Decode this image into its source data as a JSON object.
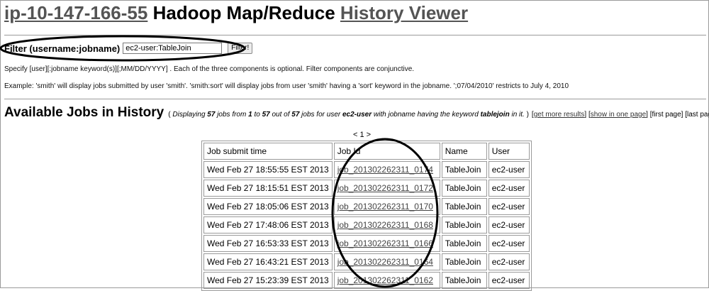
{
  "header": {
    "host": "ip-10-147-166-55",
    "middle": " Hadoop Map/Reduce ",
    "viewer": "History Viewer"
  },
  "filter": {
    "label": "Filter (username:jobname)",
    "value": "ec2-user:TableJoin",
    "button": "Filter!"
  },
  "notes": {
    "spec": "Specify [user][:jobname keyword(s)][;MM/DD/YYYY] . Each of the three components is optional. Filter components are conjunctive.",
    "example": "Example: 'smith' will display jobs submitted by user 'smith'. 'smith:sort' will display jobs from user 'smith' having a 'sort' keyword in the jobname. ';07/04/2010' restricts to July 4, 2010"
  },
  "jobs_section": {
    "heading": "Available Jobs in History",
    "open_paren": " ( ",
    "d1": "Displaying ",
    "shown": "57",
    "d2": " jobs from ",
    "from": "1",
    "d3": " to ",
    "to": "57",
    "d4": " out of ",
    "total": "57",
    "d5": " jobs for user ",
    "user": "ec2-user",
    "d6": " with jobname having the keyword ",
    "keyword": "tablejoin",
    "d7": " in it.",
    "close_paren": " ) ",
    "get_more": "get more results",
    "show_one_page": "show in one page",
    "first_page": "[first page]",
    "last_page": "[last page]"
  },
  "pager": {
    "prev": "< ",
    "page": "1",
    "next": " >"
  },
  "table": {
    "headers": [
      "Job submit time",
      "Job Id",
      "Name",
      "User"
    ],
    "rows": [
      [
        "Wed Feb 27 18:55:55 EST 2013",
        "job_201302262311_0174",
        "TableJoin",
        "ec2-user"
      ],
      [
        "Wed Feb 27 18:15:51 EST 2013",
        "job_201302262311_0172",
        "TableJoin",
        "ec2-user"
      ],
      [
        "Wed Feb 27 18:05:06 EST 2013",
        "job_201302262311_0170",
        "TableJoin",
        "ec2-user"
      ],
      [
        "Wed Feb 27 17:48:06 EST 2013",
        "job_201302262311_0168",
        "TableJoin",
        "ec2-user"
      ],
      [
        "Wed Feb 27 16:53:33 EST 2013",
        "job_201302262311_0166",
        "TableJoin",
        "ec2-user"
      ],
      [
        "Wed Feb 27 16:43:21 EST 2013",
        "job_201302262311_0164",
        "TableJoin",
        "ec2-user"
      ],
      [
        "Wed Feb 27 15:23:39 EST 2013",
        "job_201302262311_0162",
        "TableJoin",
        "ec2-user"
      ]
    ]
  }
}
